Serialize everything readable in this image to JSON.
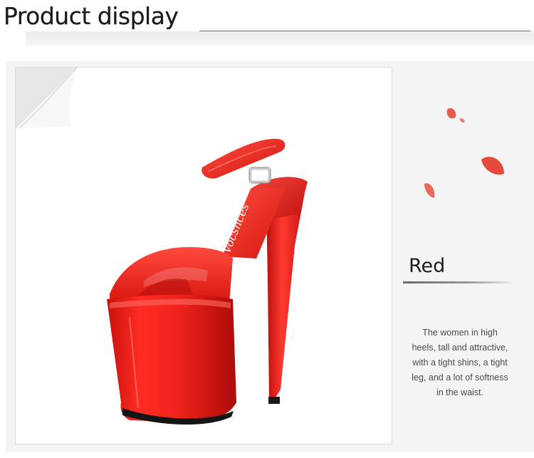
{
  "header": {
    "title": "Product display"
  },
  "product": {
    "brand_on_strap": "Vocsnces",
    "color_accent": "#e8322c"
  },
  "info": {
    "color_name": "Red",
    "description": "The women in high heels, tall and attractive, with a tight shins, a tight leg, and a lot of softness in the waist."
  }
}
